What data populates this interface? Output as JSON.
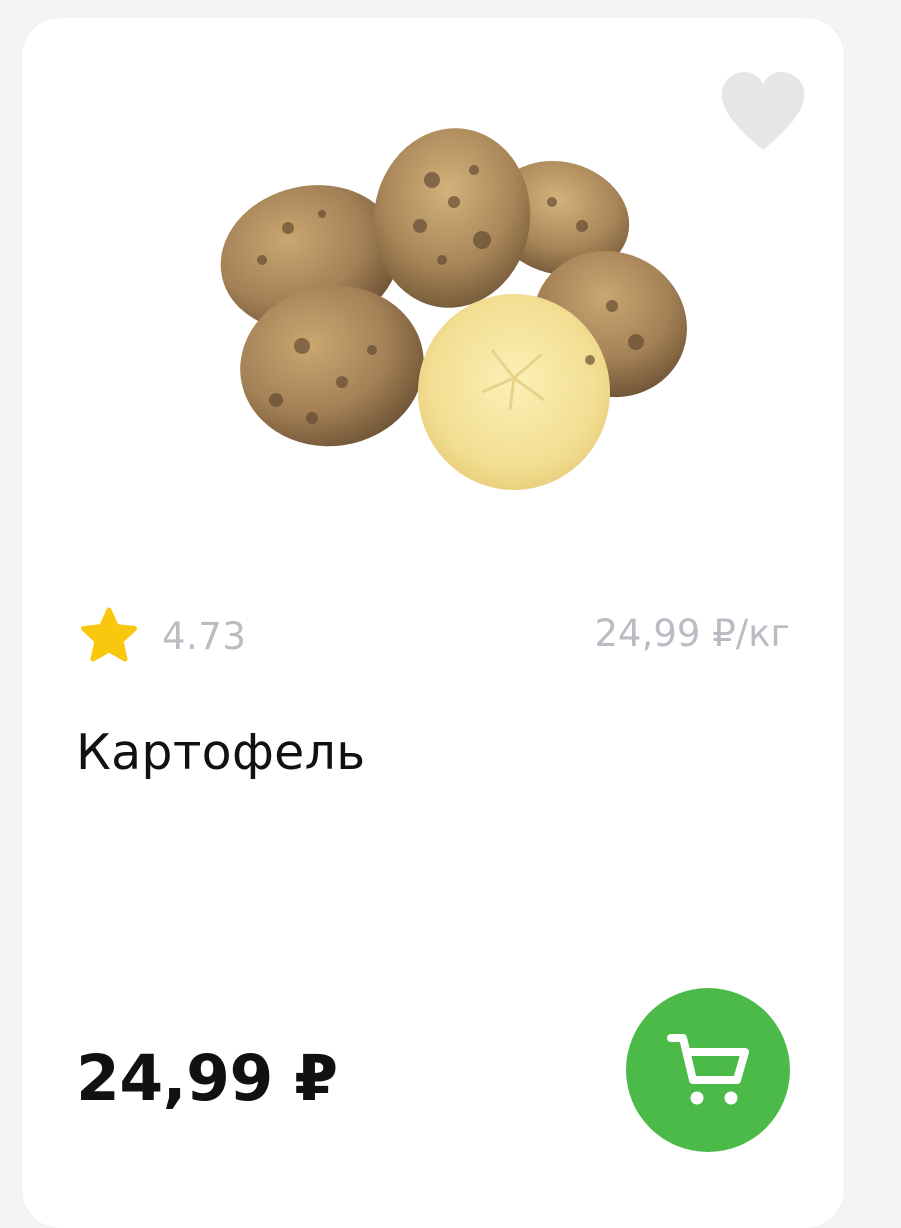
{
  "product": {
    "title": "Картофель",
    "rating": "4.73",
    "unit_price": "24,99 ₽/кг",
    "price": "24,99 ₽"
  },
  "icons": {
    "favorite": "heart-icon",
    "rating": "star-icon",
    "cart": "cart-icon"
  },
  "colors": {
    "accent_green": "#4cba49",
    "star_yellow": "#f9c80e",
    "muted_text": "#b9bcc3",
    "favorite_gray": "#e5e6e8"
  }
}
